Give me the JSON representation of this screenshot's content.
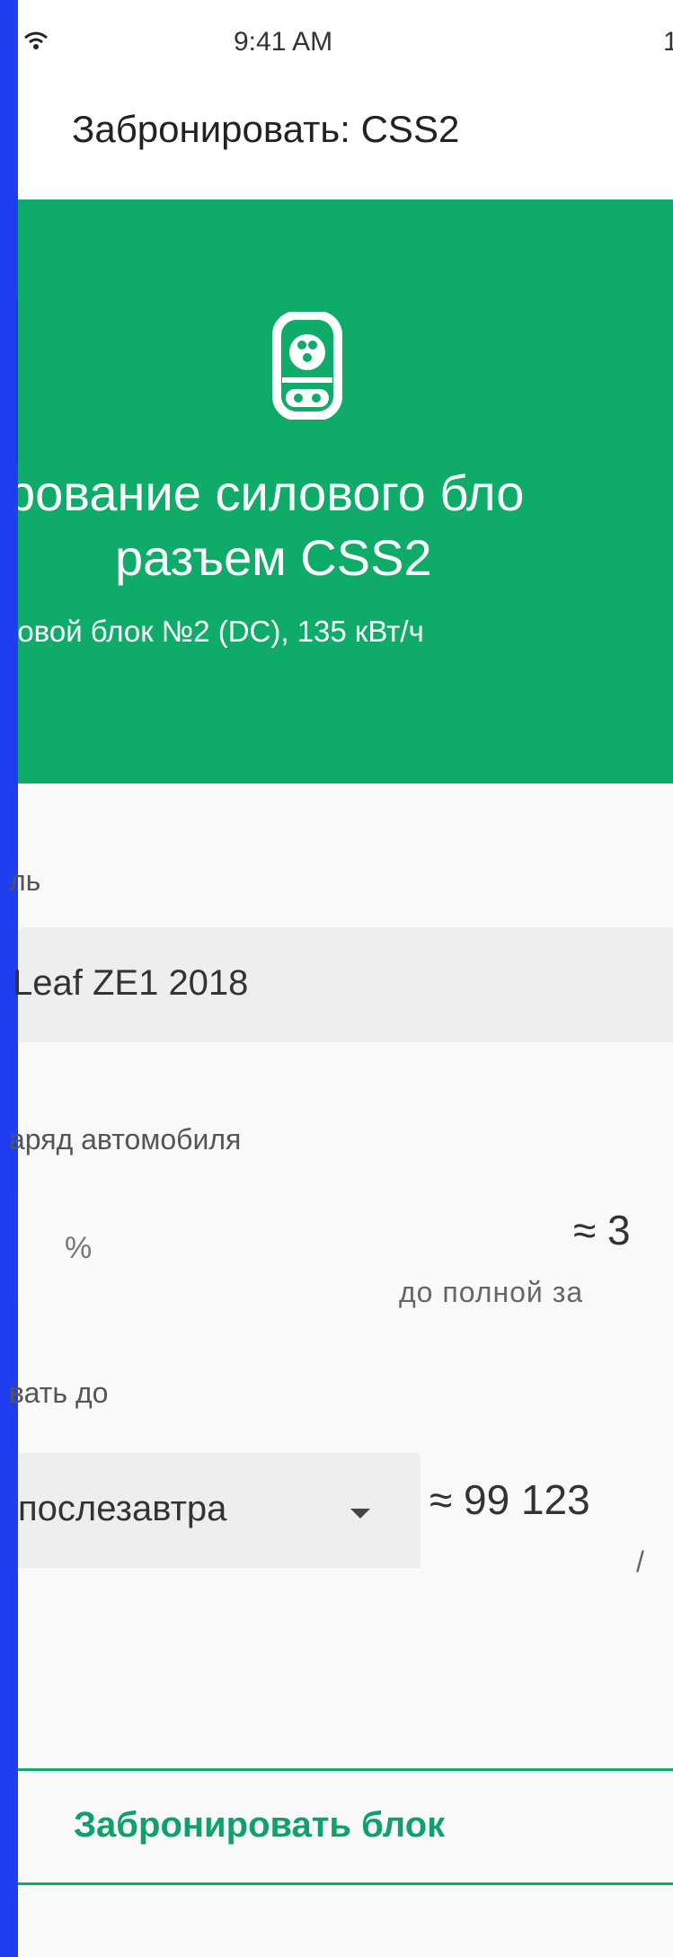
{
  "status_bar": {
    "time": "9:41 AM",
    "right_fragment": "1"
  },
  "app_bar": {
    "title": "Забронировать: CSS2"
  },
  "hero": {
    "title_line1": "рование силового бло",
    "title_line2": "разъем CSS2",
    "subtitle": "іовой блок №2 (DC), 135 кВт/ч",
    "icon": "ev-connector-icon",
    "color": "#0eac68"
  },
  "vehicle": {
    "label": "ль",
    "value": "Leaf ZE1 2018"
  },
  "charge": {
    "label": "аряд автомобиля",
    "unit": "%",
    "estimate": "≈ 3",
    "estimate_sub": "до полной за"
  },
  "book_until": {
    "label": "вать до",
    "selected": "послезавтра",
    "price": "≈ 99 123",
    "price_sub": "/ "
  },
  "actions": {
    "book_label": "Забронировать блок"
  }
}
